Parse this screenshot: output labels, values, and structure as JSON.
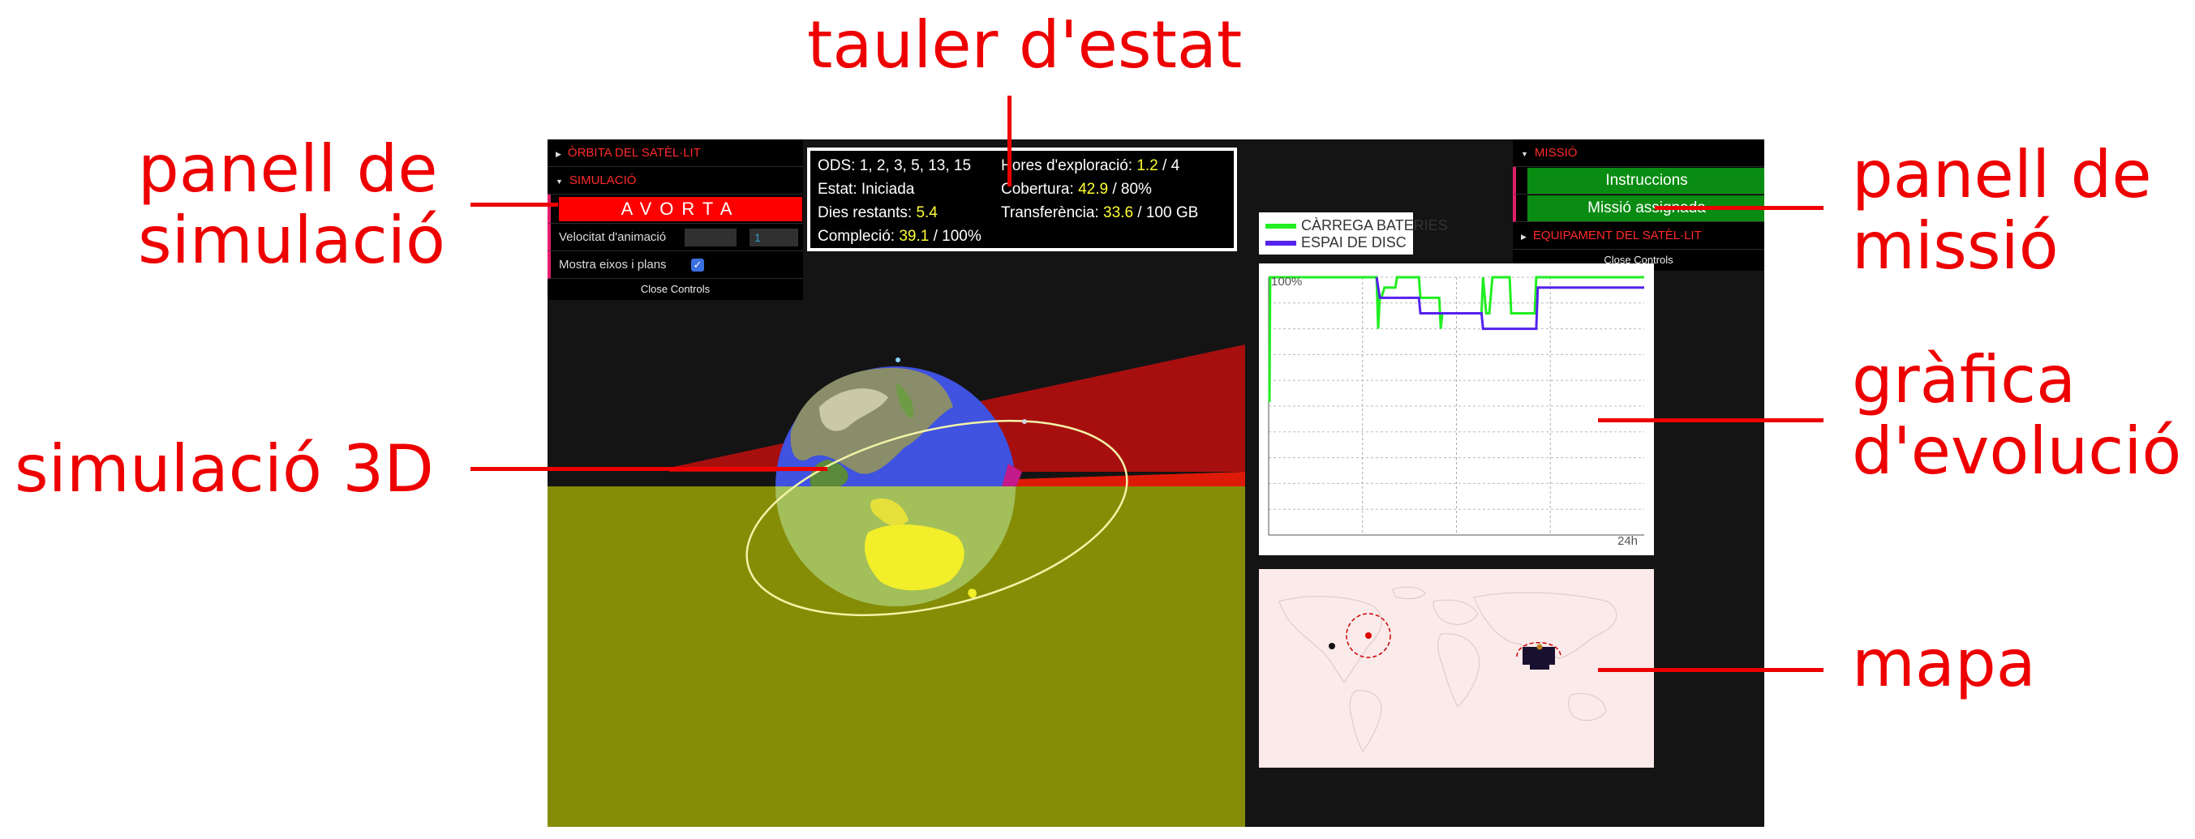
{
  "callouts": {
    "status_panel": "tauler d'estat",
    "sim_panel_line1": "panell de",
    "sim_panel_line2": "simulació",
    "sim3d": "simulació 3D",
    "mission_panel_line1": "panell de",
    "mission_panel_line2": "missió",
    "chart_line1": "gràfica",
    "chart_line2": "d'evolució",
    "map": "mapa"
  },
  "left_gui": {
    "folder_orbit": "ÒRBITA DEL SATÈL·LIT",
    "folder_sim": "SIMULACIÓ",
    "abort_label": "AVORTA",
    "anim_speed_label": "Velocitat d'animació",
    "anim_speed_value": "1",
    "show_axes_label": "Mostra eixos i plans",
    "show_axes_checked": true,
    "close_label": "Close Controls"
  },
  "status": {
    "ods_label": "ODS:",
    "ods_value": "1, 2, 3, 5, 13, 15",
    "state_label": "Estat:",
    "state_value": "Iniciada",
    "days_label": "Dies restants:",
    "days_value": "5.4",
    "completion_label": "Compleció:",
    "completion_value": "39.1",
    "completion_total": "/ 100%",
    "hours_label": "Hores d'exploració:",
    "hours_value": "1.2",
    "hours_total": "/ 4",
    "coverage_label": "Cobertura:",
    "coverage_value": "42.9",
    "coverage_total": "/ 80%",
    "transfer_label": "Transferència:",
    "transfer_value": "33.6",
    "transfer_total": "/ 100 GB"
  },
  "right_gui": {
    "folder_mission": "MISSIÓ",
    "instructions_label": "Instruccions",
    "assigned_label": "Missió assignada",
    "folder_equipment": "EQUIPAMENT DEL SATÈL·LIT",
    "close_label": "Close Controls"
  },
  "legend": {
    "battery": "CÀRREGA BATERIES",
    "disk": "ESPAI DE DISC",
    "battery_color": "#22ee22",
    "disk_color": "#5522ee"
  },
  "chart_data": {
    "type": "line",
    "ylabel_top": "100%",
    "xlabel_end": "24h",
    "ylim": [
      0,
      100
    ],
    "xlim": [
      0,
      24
    ],
    "grid": true,
    "series": [
      {
        "name": "CÀRREGA BATERIES",
        "color": "#22ee22",
        "x": [
          0,
          0.05,
          0.1,
          0.2,
          6.9,
          7.0,
          7.1,
          7.2,
          7.4,
          8.1,
          8.2,
          9.6,
          9.7,
          10.9,
          11.0,
          11.1,
          11.2,
          13.6,
          13.7,
          13.9,
          14.0,
          14.1,
          14.3,
          15.4,
          15.5,
          17.0,
          17.1,
          24
        ],
        "values": [
          52,
          52,
          100,
          100,
          100,
          80,
          92,
          92,
          96,
          96,
          100,
          100,
          92,
          92,
          80,
          86,
          86,
          86,
          100,
          86,
          86,
          86,
          100,
          100,
          86,
          86,
          100,
          100
        ]
      },
      {
        "name": "ESPAI DE DISC",
        "color": "#5522ee",
        "x": [
          6.9,
          7.1,
          9.6,
          9.7,
          13.6,
          13.7,
          17.1,
          17.2,
          24
        ],
        "values": [
          100,
          92,
          92,
          86,
          86,
          80,
          80,
          96,
          96
        ]
      }
    ]
  },
  "colors": {
    "ground": "#858d06",
    "red_plane": "#d01010",
    "ocean": "#3f52e0",
    "orbit": "#f3f3a8"
  }
}
